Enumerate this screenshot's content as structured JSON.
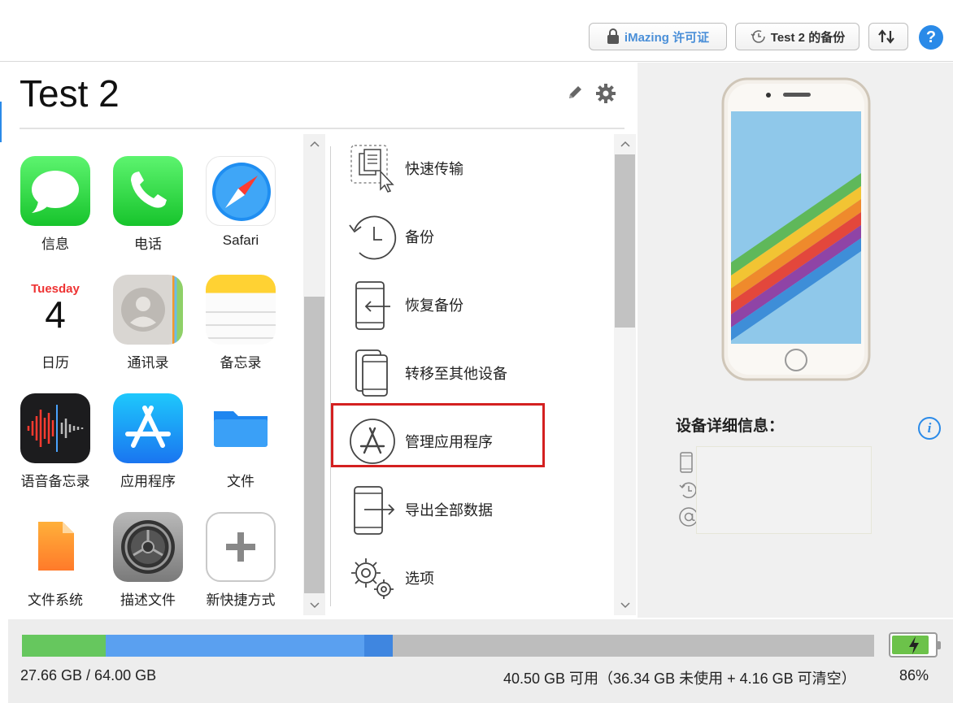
{
  "toolbar": {
    "license_label": "iMazing 许可证",
    "backup_label": "Test 2 的备份",
    "help_label": "?"
  },
  "device": {
    "name": "Test 2"
  },
  "apps": [
    {
      "label": "信息",
      "icon": "messages-icon"
    },
    {
      "label": "电话",
      "icon": "phone-icon"
    },
    {
      "label": "Safari",
      "icon": "safari-icon"
    },
    {
      "label": "日历",
      "icon": "calendar-icon",
      "day_name": "Tuesday",
      "day_number": "4"
    },
    {
      "label": "通讯录",
      "icon": "contacts-icon"
    },
    {
      "label": "备忘录",
      "icon": "notes-icon"
    },
    {
      "label": "语音备忘录",
      "icon": "voice-memos-icon"
    },
    {
      "label": "应用程序",
      "icon": "app-store-icon"
    },
    {
      "label": "文件",
      "icon": "files-icon"
    },
    {
      "label": "文件系统",
      "icon": "file-system-icon"
    },
    {
      "label": "描述文件",
      "icon": "profiles-icon"
    },
    {
      "label": "新快捷方式",
      "icon": "add-shortcut-icon"
    }
  ],
  "actions": [
    {
      "label": "快速传输",
      "icon": "quick-transfer-icon"
    },
    {
      "label": "备份",
      "icon": "backup-icon"
    },
    {
      "label": "恢复备份",
      "icon": "restore-backup-icon"
    },
    {
      "label": "转移至其他设备",
      "icon": "transfer-device-icon"
    },
    {
      "label": "管理应用程序",
      "icon": "manage-apps-icon",
      "highlighted": true
    },
    {
      "label": "导出全部数据",
      "icon": "export-data-icon"
    },
    {
      "label": "选项",
      "icon": "options-icon"
    }
  ],
  "details": {
    "title": "设备详细信息："
  },
  "storage": {
    "used_text": "27.66 GB / 64.00 GB",
    "free_text": "40.50 GB 可用（36.34 GB 未使用 + 4.16 GB 可清空）",
    "segments": [
      {
        "name": "apps",
        "color": "#66c75e",
        "fraction": 0.098
      },
      {
        "name": "media",
        "color": "#5aa0f0",
        "fraction": 0.304
      },
      {
        "name": "other",
        "color": "#3f86e0",
        "fraction": 0.033
      }
    ],
    "bar_color": "#bdbdbd",
    "battery_text": "86%",
    "battery_level": 0.86
  },
  "colors": {
    "accent": "#2a8ae8",
    "highlight": "#d42020"
  }
}
